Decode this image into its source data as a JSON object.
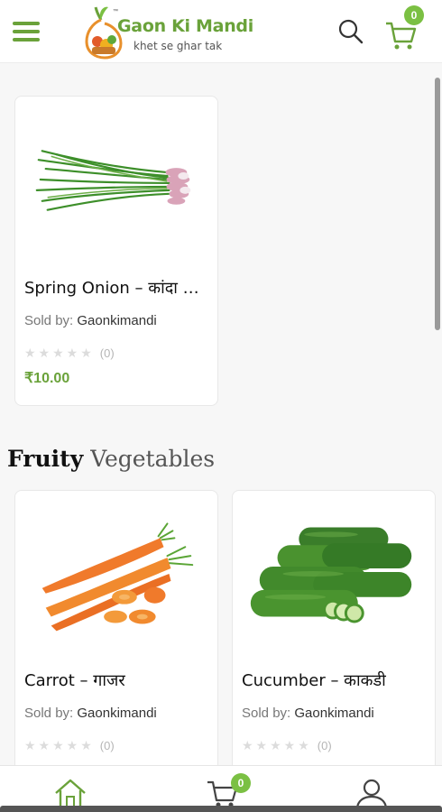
{
  "header": {
    "brand_name": "Gaon Ki Mandi",
    "brand_tagline": "khet se ghar tak",
    "trademark": "™",
    "cart_count": "0",
    "icons": [
      "menu-icon",
      "search-icon",
      "cart-icon"
    ]
  },
  "featured_product": {
    "name": "Spring Onion – कांदा …",
    "sold_by_label": "Sold by:",
    "seller": "Gaonkimandi",
    "rating_stars": "★★★★★",
    "rating_count": "(0)",
    "rating_value": 0,
    "price": "₹10.00"
  },
  "section": {
    "title_strong": "Fruity",
    "title_light": "Vegetables",
    "products": [
      {
        "name": "Carrot – गाजर",
        "sold_by_label": "Sold by:",
        "seller": "Gaonkimandi",
        "rating_stars": "★★★★★",
        "rating_count": "(0)",
        "rating_value": 0
      },
      {
        "name": "Cucumber – काकडी",
        "sold_by_label": "Sold by:",
        "seller": "Gaonkimandi",
        "rating_stars": "★★★★★",
        "rating_count": "(0)",
        "rating_value": 0
      }
    ]
  },
  "bottom_nav": {
    "cart_count": "0",
    "items": [
      "home-icon",
      "cart-icon",
      "account-icon"
    ]
  },
  "colors": {
    "brand_green": "#6aa23a",
    "badge_green": "#7bc043",
    "star_empty": "#dcdcdc"
  }
}
